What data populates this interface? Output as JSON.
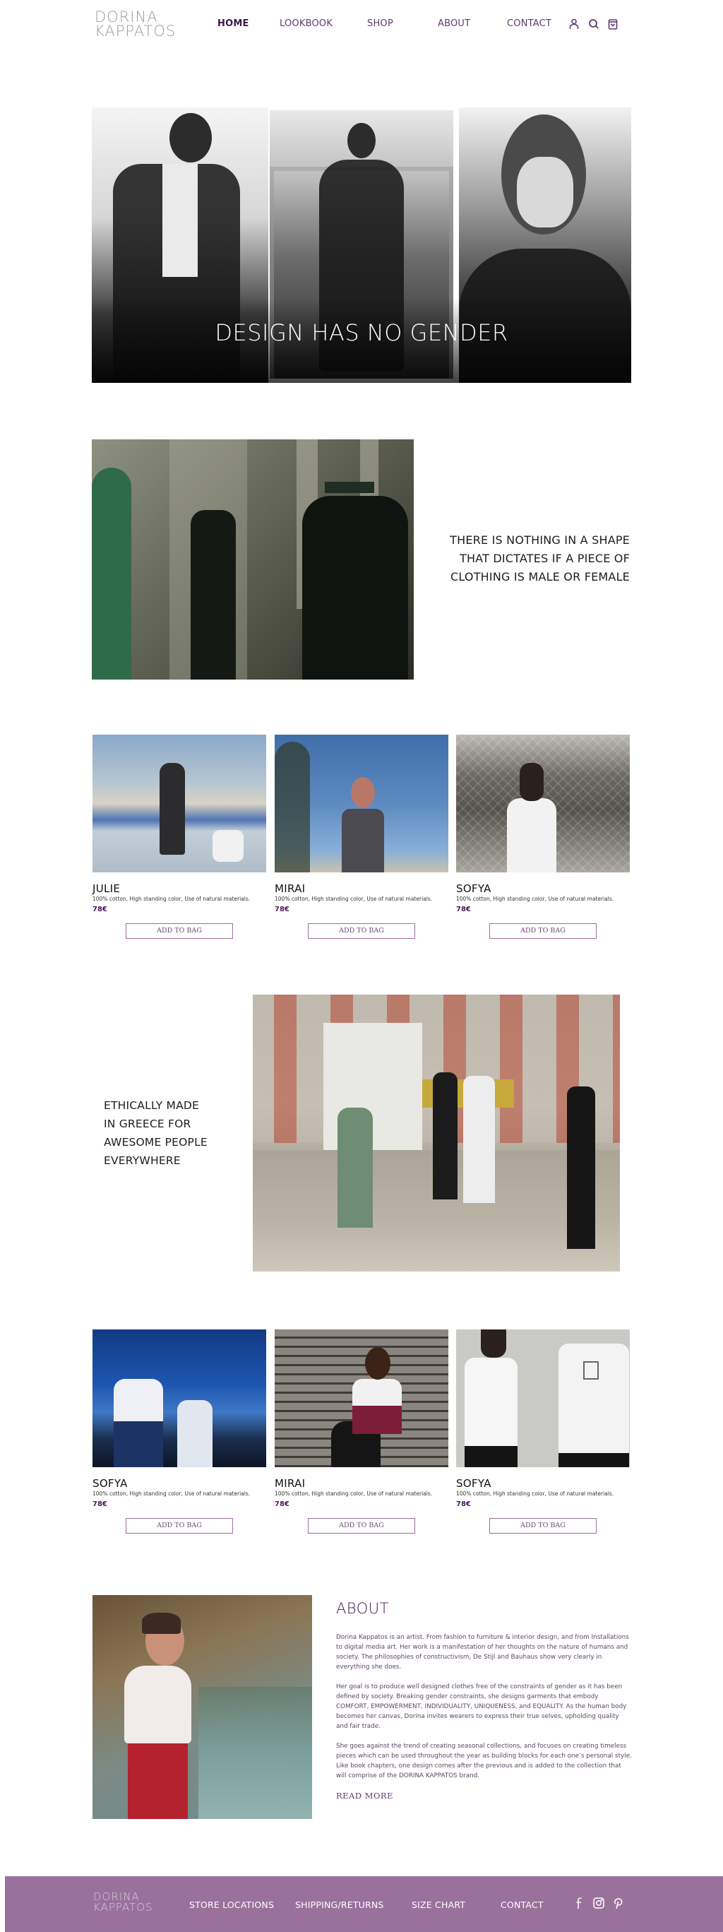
{
  "header": {
    "logo": {
      "line1": "DORINA",
      "line2": "KAPPATOS"
    },
    "nav": [
      {
        "label": "HOME",
        "active": true
      },
      {
        "label": "LOOKBOOK",
        "active": false
      },
      {
        "label": "SHOP",
        "active": false
      },
      {
        "label": "ABOUT",
        "active": false
      },
      {
        "label": "CONTACT",
        "active": false
      }
    ],
    "icons": [
      "user-icon",
      "search-icon",
      "shopping-bag-icon"
    ]
  },
  "hero": {
    "title": "DESIGN HAS NO GENDER"
  },
  "feature1": {
    "quote_lines": [
      "THERE IS NOTHING IN A SHAPE",
      "THAT DICTATES IF A PIECE OF",
      "CLOTHING IS MALE OR FEMALE"
    ]
  },
  "products_row1": [
    {
      "name": "JULIE",
      "description": "100% cotton, High standing color, Use of natural materials.",
      "price": "78€",
      "button": "ADD TO BAG"
    },
    {
      "name": "MIRAI",
      "description": "100% cotton, High standing color, Use of natural materials.",
      "price": "78€",
      "button": "ADD TO BAG"
    },
    {
      "name": "SOFYA",
      "description": "100% cotton, High standing color, Use of natural materials.",
      "price": "78€",
      "button": "ADD TO BAG"
    }
  ],
  "feature2": {
    "quote_lines": [
      "ETHICALLY MADE",
      "IN GREECE FOR",
      "AWESOME PEOPLE",
      "EVERYWHERE"
    ]
  },
  "products_row2": [
    {
      "name": "SOFYA",
      "description": "100% cotton, High standing color, Use of natural materials.",
      "price": "78€",
      "button": "ADD TO BAG"
    },
    {
      "name": "MIRAI",
      "description": "100% cotton, High standing color, Use of natural materials.",
      "price": "78€",
      "button": "ADD TO BAG"
    },
    {
      "name": "SOFYA",
      "description": "100% cotton, High standing color, Use of natural materials.",
      "price": "78€",
      "button": "ADD TO BAG"
    }
  ],
  "about": {
    "title": "ABOUT",
    "paragraphs": [
      "Dorina Kappatos is an artist. From fashion to furniture & interior design, and from Installations to digital media art. Her work is a manifestation of her thoughts on the nature of humans and society. The philosophies of constructivism, De Stijl and Bauhaus show very clearly in everything she does.",
      "Her goal is to produce well designed clothes free of the constraints of gender as it has been defined by society. Breaking gender constraints, she designs garments that embody COMFORT, EMPOWERMENT, INDIVIDUALITY, UNIQUENESS, and EQUALITY. As the human body becomes her canvas, Dorina invites wearers to express their true selves, upholding quality and fair trade.",
      "She goes against the trend of creating seasonal collections, and focuses on creating timeless pieces which can be used throughout the year as building blocks for each one’s personal style. Like book chapters, one design comes after the previous and is added to the collection that will comprise of the DORINA KAPPATOS brand."
    ],
    "read_more": "READ MORE"
  },
  "footer": {
    "logo": {
      "line1": "DORINA",
      "line2": "KAPPATOS"
    },
    "links": [
      "STORE LOCATIONS",
      "SHIPPING/RETURNS",
      "SIZE CHART",
      "CONTACT"
    ],
    "social": [
      "facebook-icon",
      "instagram-icon",
      "pinterest-icon"
    ],
    "background_color": "#9a719d"
  },
  "colors": {
    "brand_purple": "#5e3a6f",
    "dark_purple": "#3a1848",
    "button_border": "#9b6ea0"
  }
}
